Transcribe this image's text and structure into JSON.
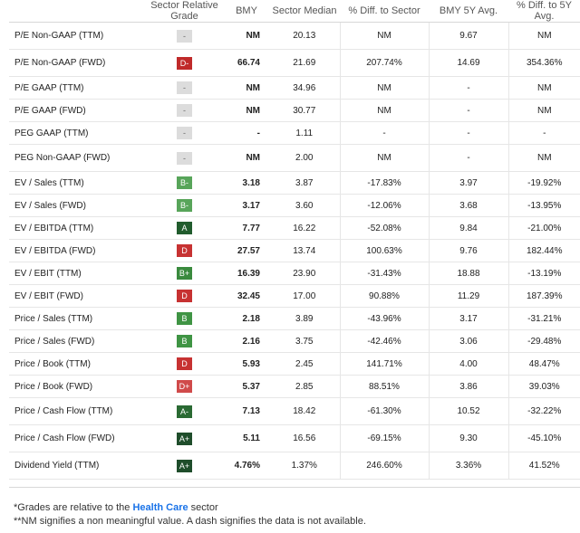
{
  "headers": [
    "Sector Relative Grade",
    "BMY",
    "Sector Median",
    "% Diff. to Sector",
    "BMY 5Y Avg.",
    "% Diff. to 5Y Avg."
  ],
  "rows": [
    {
      "metric": "P/E Non-GAAP (TTM)",
      "grade": "-",
      "bmy": "NM",
      "median": "20.13",
      "diff": "NM",
      "avg": "9.67",
      "diff5": "NM",
      "tall": true
    },
    {
      "metric": "P/E Non-GAAP (FWD)",
      "grade": "D-",
      "bmy": "66.74",
      "median": "21.69",
      "diff": "207.74%",
      "avg": "14.69",
      "diff5": "354.36%",
      "tall": true
    },
    {
      "metric": "P/E GAAP (TTM)",
      "grade": "-",
      "bmy": "NM",
      "median": "34.96",
      "diff": "NM",
      "avg": "-",
      "diff5": "NM"
    },
    {
      "metric": "P/E GAAP (FWD)",
      "grade": "-",
      "bmy": "NM",
      "median": "30.77",
      "diff": "NM",
      "avg": "-",
      "diff5": "NM"
    },
    {
      "metric": "PEG GAAP (TTM)",
      "grade": "-",
      "bmy": "-",
      "median": "1.11",
      "diff": "-",
      "avg": "-",
      "diff5": "-"
    },
    {
      "metric": "PEG Non-GAAP (FWD)",
      "grade": "-",
      "bmy": "NM",
      "median": "2.00",
      "diff": "NM",
      "avg": "-",
      "diff5": "NM",
      "tall": true
    },
    {
      "metric": "EV / Sales (TTM)",
      "grade": "B-",
      "bmy": "3.18",
      "median": "3.87",
      "diff": "-17.83%",
      "avg": "3.97",
      "diff5": "-19.92%"
    },
    {
      "metric": "EV / Sales (FWD)",
      "grade": "B-",
      "bmy": "3.17",
      "median": "3.60",
      "diff": "-12.06%",
      "avg": "3.68",
      "diff5": "-13.95%"
    },
    {
      "metric": "EV / EBITDA (TTM)",
      "grade": "A",
      "bmy": "7.77",
      "median": "16.22",
      "diff": "-52.08%",
      "avg": "9.84",
      "diff5": "-21.00%"
    },
    {
      "metric": "EV / EBITDA (FWD)",
      "grade": "D",
      "bmy": "27.57",
      "median": "13.74",
      "diff": "100.63%",
      "avg": "9.76",
      "diff5": "182.44%"
    },
    {
      "metric": "EV / EBIT (TTM)",
      "grade": "B+",
      "bmy": "16.39",
      "median": "23.90",
      "diff": "-31.43%",
      "avg": "18.88",
      "diff5": "-13.19%"
    },
    {
      "metric": "EV / EBIT (FWD)",
      "grade": "D",
      "bmy": "32.45",
      "median": "17.00",
      "diff": "90.88%",
      "avg": "11.29",
      "diff5": "187.39%"
    },
    {
      "metric": "Price / Sales (TTM)",
      "grade": "B",
      "bmy": "2.18",
      "median": "3.89",
      "diff": "-43.96%",
      "avg": "3.17",
      "diff5": "-31.21%"
    },
    {
      "metric": "Price / Sales (FWD)",
      "grade": "B",
      "bmy": "2.16",
      "median": "3.75",
      "diff": "-42.46%",
      "avg": "3.06",
      "diff5": "-29.48%"
    },
    {
      "metric": "Price / Book (TTM)",
      "grade": "D",
      "bmy": "5.93",
      "median": "2.45",
      "diff": "141.71%",
      "avg": "4.00",
      "diff5": "48.47%"
    },
    {
      "metric": "Price / Book (FWD)",
      "grade": "D+",
      "bmy": "5.37",
      "median": "2.85",
      "diff": "88.51%",
      "avg": "3.86",
      "diff5": "39.03%"
    },
    {
      "metric": "Price / Cash Flow (TTM)",
      "grade": "A-",
      "bmy": "7.13",
      "median": "18.42",
      "diff": "-61.30%",
      "avg": "10.52",
      "diff5": "-32.22%",
      "tall": true
    },
    {
      "metric": "Price / Cash Flow (FWD)",
      "grade": "A+",
      "bmy": "5.11",
      "median": "16.56",
      "diff": "-69.15%",
      "avg": "9.30",
      "diff5": "-45.10%",
      "tall": true
    },
    {
      "metric": "Dividend Yield (TTM)",
      "grade": "A+",
      "bmy": "4.76%",
      "median": "1.37%",
      "diff": "246.60%",
      "avg": "3.36%",
      "diff5": "41.52%",
      "tall": true
    }
  ],
  "footnote1": {
    "prefix": "*Grades are relative to the ",
    "link": "Health Care",
    "suffix": " sector"
  },
  "footnote2": "**NM signifies a non meaningful value. A dash signifies the data is not available.",
  "colors": {
    "link": "#1a73e8",
    "grade_green_dark": "#1f4d2b",
    "grade_red": "#c73232",
    "grade_dash": "#dcdcdc"
  }
}
